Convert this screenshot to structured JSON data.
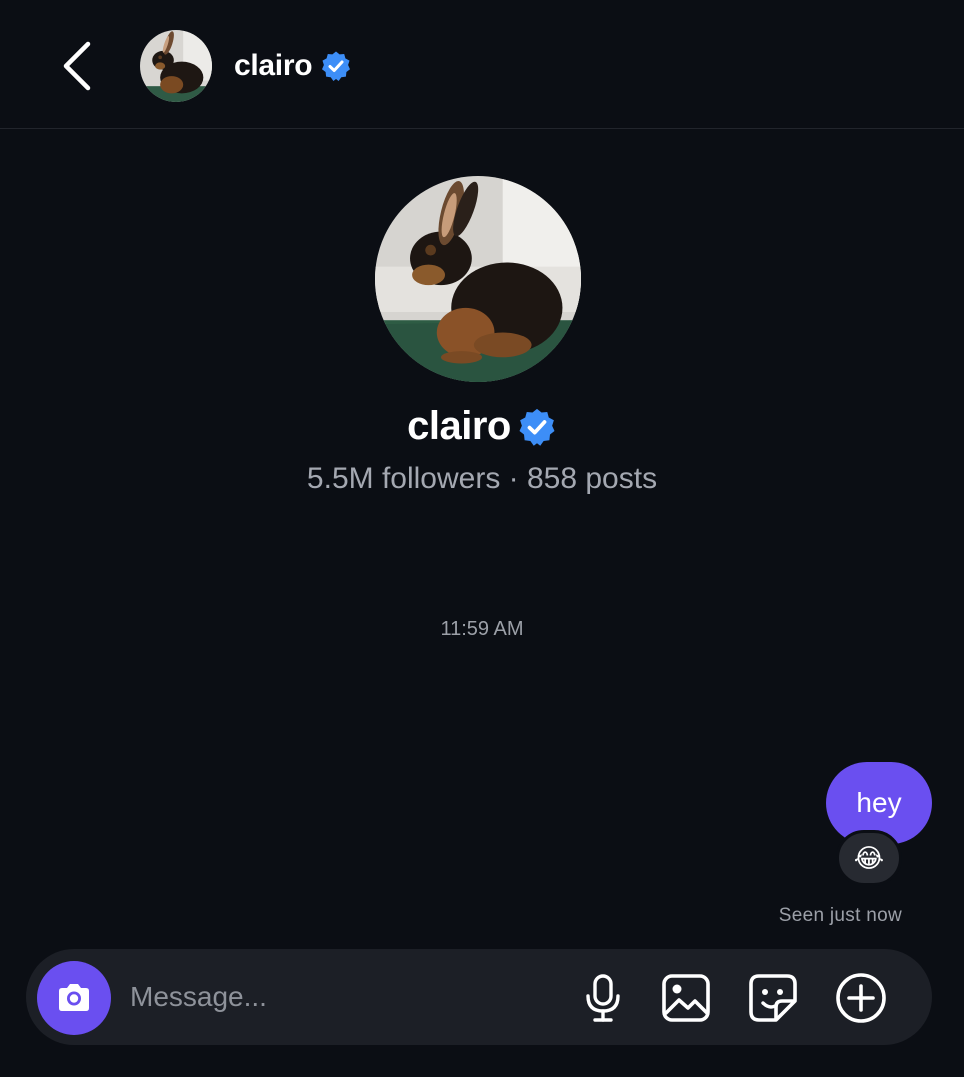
{
  "header": {
    "username": "clairo",
    "verified_icon": "verified-badge-icon",
    "back_icon": "chevron-left-icon"
  },
  "profile": {
    "username": "clairo",
    "stats": "5.5M followers · 858 posts",
    "avatar_subject": "rabbit-photo"
  },
  "thread": {
    "timestamp": "11:59 AM",
    "messages": [
      {
        "text": "hey",
        "from": "me"
      }
    ],
    "reaction": "😂",
    "seen_status": "Seen just now"
  },
  "composer": {
    "placeholder": "Message...",
    "value": "",
    "icons": [
      "camera-icon",
      "microphone-icon",
      "gallery-icon",
      "sticker-icon",
      "plus-icon"
    ]
  },
  "colors": {
    "background": "#0b0e14",
    "accent": "#6a4ff0",
    "verified": "#3d8ef7",
    "composer_bg": "#1c1f26",
    "muted_text": "#a4a8b1"
  }
}
